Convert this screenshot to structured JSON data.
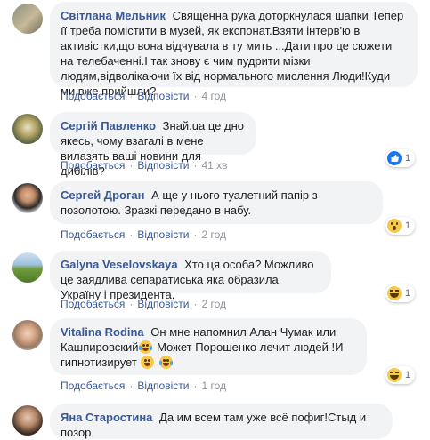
{
  "comments": [
    {
      "author": "Світлана Мельник",
      "text": "Священна рука доторкнулася шапки Тепер її треба помістити в музей, як експонат.Взяти інтерв'ю в активістки,що вона відчувала в ту мить ...Дати про це сюжети на телебаченні.І так знову є чим пудрити мізки людям,відволікаючи їх від нормального мислення Люди!Куди ми вже прийшли?",
      "like": "Подобається",
      "reply": "Відповісти",
      "time": "4 год"
    },
    {
      "author": "Сергій Павленко",
      "text": "Знай.ua це дно якесь, чому взагалі в мене вилазять ваші новини для дибілів?",
      "like": "Подобається",
      "reply": "Відповісти",
      "time": "41 хв",
      "reaction": {
        "icon": "like-icon",
        "count": "1",
        "color": "#1877f2"
      }
    },
    {
      "author": "Сергей Дроган",
      "text": "А ще у нього туалетний папір з позолотою. Зразкі передано в набу.",
      "like": "Подобається",
      "reply": "Відповісти",
      "time": "2 год",
      "reaction": {
        "icon": "wow-icon",
        "count": "1",
        "color": "#f7c948"
      }
    },
    {
      "author": "Galyna Veselovskaya",
      "text": "Хто ця особа? Можливо це заядлива сепаратиська яка образила Україну і президента.",
      "like": "Подобається",
      "reply": "Відповісти",
      "time": "2 год",
      "reaction": {
        "icon": "haha-icon",
        "count": "1",
        "color": "#f7c948"
      }
    },
    {
      "author": "Vitalina Rodina",
      "text_parts": [
        "Он мне напомнил Алан Чумак или Кашпировский",
        "Может Порошенко лечит людей !И гипнотизирует "
      ],
      "like": "Подобається",
      "reply": "Відповісти",
      "time": "1 год",
      "reaction": {
        "icon": "haha-icon",
        "count": "1",
        "color": "#f7c948"
      }
    },
    {
      "author": "Яна Старостина",
      "text": "Да им всем там уже всё пофиг!Стыд и позор"
    }
  ]
}
